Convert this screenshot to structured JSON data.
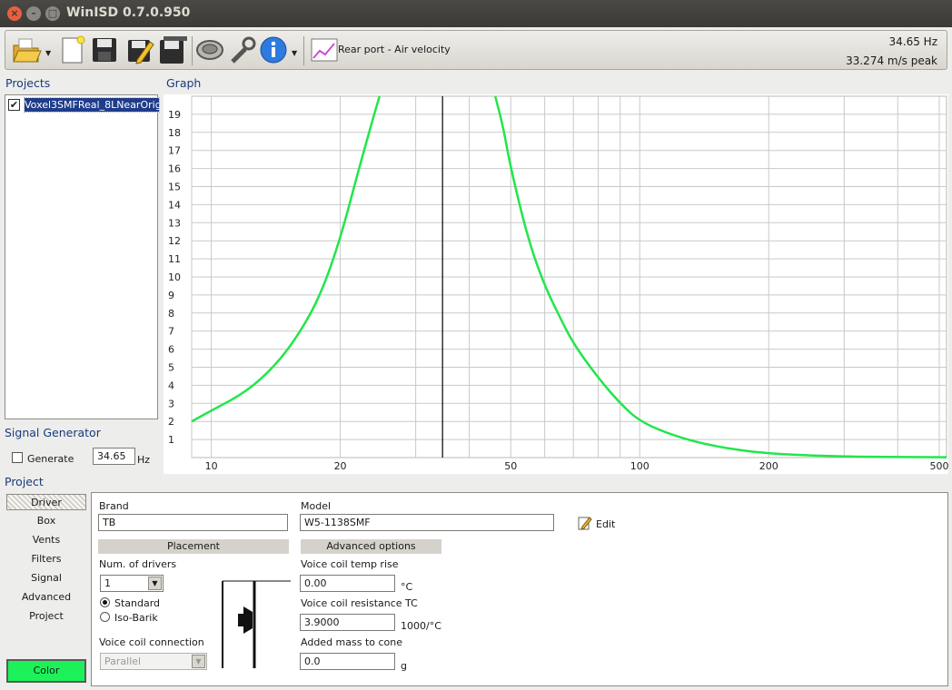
{
  "window": {
    "title": "WinISD 0.7.0.950"
  },
  "toolbar": {
    "graph_selector_label": "Rear port - Air velocity",
    "readout_frequency": "34.65 Hz",
    "readout_peak": "33.274 m/s peak",
    "icons": [
      "open-folder-icon",
      "new-document-icon",
      "save-icon",
      "save-edit-icon",
      "save-all-icon",
      "driver-icon",
      "tools-icon",
      "info-icon",
      "graph-icon"
    ]
  },
  "projects": {
    "heading": "Projects",
    "items": [
      {
        "name": "Voxel3SMFReal_8LNearOrig",
        "checked": true
      }
    ]
  },
  "signal_generator": {
    "heading": "Signal Generator",
    "generate_label": "Generate",
    "generate_checked": false,
    "frequency_value": "34.65",
    "unit": "Hz"
  },
  "graph": {
    "heading": "Graph"
  },
  "chart_data": {
    "type": "line",
    "x_scale": "log",
    "xlim": [
      9,
      520
    ],
    "ylim": [
      0,
      20
    ],
    "x_ticks": [
      10,
      20,
      50,
      100,
      200,
      500
    ],
    "y_ticks": [
      1,
      2,
      3,
      4,
      5,
      6,
      7,
      8,
      9,
      10,
      11,
      12,
      13,
      14,
      15,
      16,
      17,
      18,
      19
    ],
    "cursor_x": 34.65,
    "series": [
      {
        "color": "#22e64a",
        "x": [
          9,
          10,
          12,
          14,
          16,
          18,
          20,
          22,
          24,
          24.7,
          46,
          48,
          50,
          55,
          60,
          65,
          70,
          80,
          90,
          100,
          120,
          150,
          200,
          300,
          400,
          520
        ],
        "y": [
          2.0,
          2.6,
          3.6,
          5.0,
          6.8,
          9.0,
          12.1,
          15.8,
          19.0,
          20.0,
          20.0,
          18.3,
          16.0,
          12.0,
          9.5,
          7.8,
          6.3,
          4.4,
          3.0,
          2.0,
          1.2,
          0.6,
          0.2,
          0.06,
          0.03,
          0.02
        ]
      }
    ]
  },
  "project_panel": {
    "heading": "Project",
    "tabs": [
      "Driver",
      "Box",
      "Vents",
      "Filters",
      "Signal",
      "Advanced",
      "Project"
    ],
    "active_tab": "Driver",
    "color_button": "Color",
    "color_value": "#1df15a",
    "brand_label": "Brand",
    "brand_value": "TB",
    "model_label": "Model",
    "model_value": "W5-1138SMF",
    "edit_label": "Edit",
    "placement_header": "Placement",
    "num_drivers_label": "Num. of drivers",
    "num_drivers_value": "1",
    "placement_standard": "Standard",
    "placement_isobarik": "Iso-Barik",
    "voice_coil_connection_label": "Voice coil connection",
    "voice_coil_connection_value": "Parallel",
    "advanced_header": "Advanced options",
    "vc_temp_rise_label": "Voice coil temp rise",
    "vc_temp_rise_value": "0.00",
    "vc_temp_rise_unit": "°C",
    "vc_resistance_tc_label": "Voice coil resistance TC",
    "vc_resistance_tc_value": "3.9000",
    "vc_resistance_tc_unit": "1000/°C",
    "added_mass_label": "Added mass to cone",
    "added_mass_value": "0.0",
    "added_mass_unit": "g"
  }
}
